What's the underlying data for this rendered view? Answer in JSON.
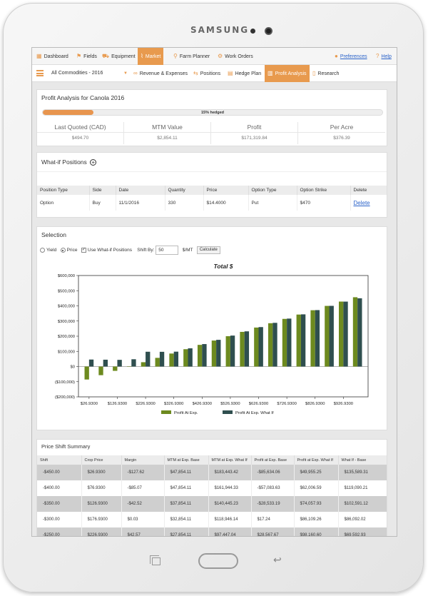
{
  "device": {
    "brand": "SAMSUNG"
  },
  "nav": {
    "items": [
      {
        "label": "Dashboard",
        "icon": "grid-icon"
      },
      {
        "label": "Fields",
        "icon": "map-pin-icon"
      },
      {
        "label": "Equipment",
        "icon": "tractor-icon"
      },
      {
        "label": "Market",
        "icon": "chart-line-icon",
        "active": true
      },
      {
        "label": "Farm Planner",
        "icon": "bookmark-icon"
      },
      {
        "label": "Work Orders",
        "icon": "gears-icon"
      }
    ],
    "preferences": "Preferences",
    "help": "Help"
  },
  "subnav": {
    "commodity": "All Commodities - 2016",
    "items": [
      {
        "label": "Revenue & Expenses"
      },
      {
        "label": "Positions"
      },
      {
        "label": "Hedge Plan"
      },
      {
        "label": "Profit Analysis",
        "active": true
      },
      {
        "label": "Research"
      }
    ]
  },
  "profit": {
    "title": "Profit Analysis for Canola 2016",
    "hedged_label": "15% hedged",
    "hedged_fraction": 0.15,
    "metrics": [
      {
        "label": "Last Quoted (CAD)",
        "value": "$494.70"
      },
      {
        "label": "MTM Value",
        "value": "$2,854.11"
      },
      {
        "label": "Profit",
        "value": "$171,319.84"
      },
      {
        "label": "Per Acre",
        "value": "$376.39"
      }
    ]
  },
  "whatif": {
    "title": "What-if Positions",
    "headers": [
      "Position Type",
      "Side",
      "Date",
      "Quantity",
      "Price",
      "Option Type",
      "Option Strike",
      "Delete"
    ],
    "row": [
      "Option",
      "Buy",
      "11/1/2016",
      "330",
      "$14.4000",
      "Put",
      "$470",
      "Delete"
    ]
  },
  "selection": {
    "title": "Selection",
    "yield": "Yield",
    "price": "Price",
    "use_whatif": "Use What-if Positions",
    "shift_by": "Shift By:",
    "shift_value": "50",
    "unit": "$/MT",
    "calculate": "Calculate"
  },
  "chart_data": {
    "type": "bar",
    "title": "Total $",
    "ytick_labels": [
      "$600,000",
      "$500,000",
      "$400,000",
      "$300,000",
      "$200,000",
      "$100,000",
      "$0",
      "($100,000)",
      "($200,000)"
    ],
    "yticks": [
      600000,
      500000,
      400000,
      300000,
      200000,
      100000,
      0,
      -100000,
      -200000
    ],
    "ylim": [
      -200000,
      600000
    ],
    "xtick_labels": [
      "$26.9300",
      "$126.9300",
      "$226.9300",
      "$326.9300",
      "$426.9300",
      "$526.9300",
      "$626.9300",
      "$726.9300",
      "$826.9300",
      "$926.9300"
    ],
    "series": [
      {
        "name": "Profit At Exp.",
        "color": "#6d8a1f",
        "values": [
          -85634,
          -57083,
          -28533,
          17,
          28568,
          57118,
          85668,
          114218,
          142768,
          171318,
          199868,
          228418,
          256968,
          285518,
          314068,
          342618,
          371168,
          399718,
          428268,
          456818
        ]
      },
      {
        "name": "Profit At Exp. What If",
        "color": "#2f4f4f",
        "values": [
          46000,
          45000,
          44000,
          48000,
          97447,
          97000,
          98000,
          120000,
          148000,
          176000,
          204000,
          232000,
          260000,
          288000,
          316000,
          344000,
          372000,
          400000,
          428000,
          450000
        ]
      }
    ]
  },
  "summary": {
    "title": "Price Shift Summary",
    "headers": [
      "Shift",
      "Crop Price",
      "Margin",
      "MTM at Exp. Base",
      "MTM at Exp. What If",
      "Profit at Exp. Base",
      "Profit at Exp. What If",
      "What If - Base"
    ],
    "rows": [
      [
        "-$450.00",
        "$26.9300",
        "-$127.62",
        "$47,854.11",
        "$183,443.42",
        "-$85,634.06",
        "$49,955.25",
        "$135,589.31"
      ],
      [
        "-$400.00",
        "$76.9300",
        "-$85.07",
        "$47,854.11",
        "$161,944.33",
        "-$57,083.63",
        "$62,006.59",
        "$119,090.21"
      ],
      [
        "-$350.00",
        "$126.9300",
        "-$42.52",
        "$37,854.11",
        "$140,445.23",
        "-$28,533.19",
        "$74,057.93",
        "$102,591.12"
      ],
      [
        "-$300.00",
        "$176.9300",
        "$0.03",
        "$32,854.11",
        "$118,946.14",
        "$17.24",
        "$86,109.26",
        "$86,092.02"
      ],
      [
        "-$250.00",
        "$226.9300",
        "$42.57",
        "$27,854.11",
        "$97,447.04",
        "$28,567.67",
        "$98,160.60",
        "$69,592.93"
      ]
    ]
  }
}
